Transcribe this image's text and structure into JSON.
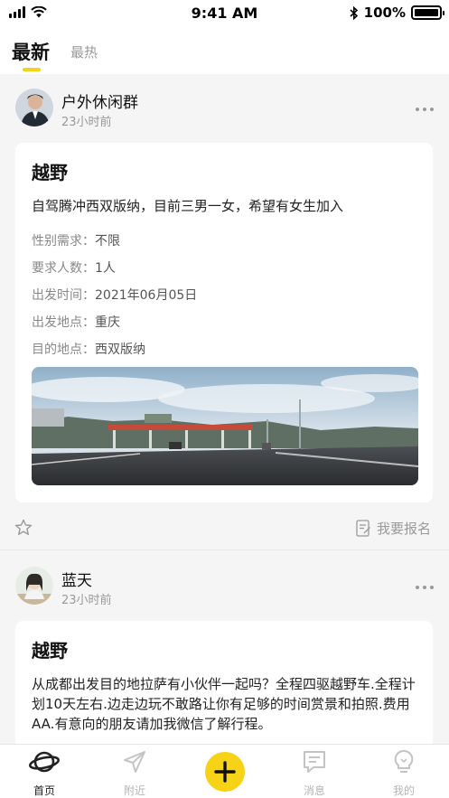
{
  "status_bar": {
    "time": "9:41 AM",
    "battery": "100%"
  },
  "tabs": [
    {
      "label": "最新",
      "active": true
    },
    {
      "label": "最热",
      "active": false
    }
  ],
  "posts": [
    {
      "user": "户外休闲群",
      "time": "23小时前",
      "title": "越野",
      "description": "自驾腾冲西双版纳，目前三男一女，希望有女生加入",
      "fields": [
        {
          "label": "性别需求：",
          "value": "不限"
        },
        {
          "label": "要求人数：",
          "value": "1人"
        },
        {
          "label": "出发时间：",
          "value": "2021年06月05日"
        },
        {
          "label": "出发地点：",
          "value": "重庆"
        },
        {
          "label": "目的地点：",
          "value": "西双版纳"
        }
      ],
      "signup_label": "我要报名"
    },
    {
      "user": "蓝天",
      "time": "23小时前",
      "title": "越野",
      "description": "从成都出发目的地拉萨有小伙伴一起吗？全程四驱越野车.全程计划10天左右.边走边玩不敢路让你有足够的时间赏景和拍照.费用AA.有意向的朋友请加我微信了解行程。"
    }
  ],
  "nav": [
    {
      "label": "首页",
      "icon": "planet-icon",
      "active": true
    },
    {
      "label": "附近",
      "icon": "send-icon",
      "active": false
    },
    {
      "label": "",
      "icon": "plus-icon",
      "active": false
    },
    {
      "label": "消息",
      "icon": "message-icon",
      "active": false
    },
    {
      "label": "我的",
      "icon": "bulb-icon",
      "active": false
    }
  ],
  "colors": {
    "accent": "#f6d317",
    "muted": "#999999"
  }
}
